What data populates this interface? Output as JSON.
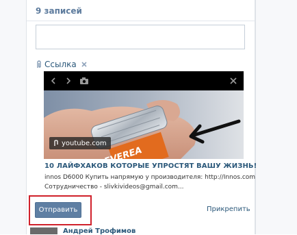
{
  "wall": {
    "records_count": "9 записей"
  },
  "composer": {
    "input_value": "",
    "attachment": {
      "type_label": "Ссылка",
      "preview": {
        "source_badge": "youtube.com",
        "title": "10 ЛАЙФХАКОВ КОТОРЫЕ УПРОСТЯТ ВАШУ ЖИЗНЬ!",
        "description_lines": [
          "innos D6000 Купить напрямую у производителя: http://Innos.com",
          "Сотрудничество - slivkivideos@gmail.com..."
        ]
      }
    },
    "send_button": "Отправить",
    "attach_link": "Прикрепить"
  },
  "next_post": {
    "author": "Андрей Трофимов"
  },
  "colors": {
    "accent": "#5f7fa3",
    "link": "#2b587a",
    "highlight": "#d0202a"
  }
}
